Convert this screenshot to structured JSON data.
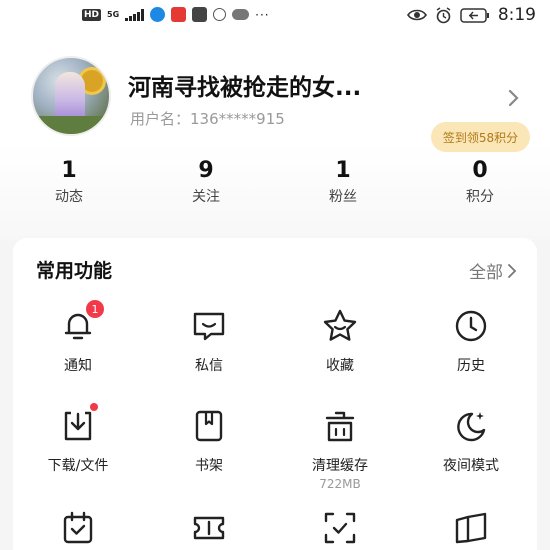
{
  "status_bar": {
    "hd": "HD",
    "network": "5G",
    "time": "8:19"
  },
  "profile": {
    "username": "河南寻找被抢走的女...",
    "user_id_label": "用户名：",
    "user_id_value": "136*****915",
    "signin_label": "签到领58积分"
  },
  "stats": [
    {
      "value": "1",
      "label": "动态"
    },
    {
      "value": "9",
      "label": "关注"
    },
    {
      "value": "1",
      "label": "粉丝"
    },
    {
      "value": "0",
      "label": "积分"
    }
  ],
  "functions": {
    "title": "常用功能",
    "view_all": "全部",
    "items": [
      {
        "label": "通知",
        "icon": "bell-icon",
        "badge": "1"
      },
      {
        "label": "私信",
        "icon": "message-icon"
      },
      {
        "label": "收藏",
        "icon": "star-icon"
      },
      {
        "label": "历史",
        "icon": "clock-icon"
      },
      {
        "label": "下载/文件",
        "icon": "download-icon",
        "dot": true
      },
      {
        "label": "书架",
        "icon": "bookshelf-icon"
      },
      {
        "label": "清理缓存",
        "icon": "trash-icon",
        "sub": "722MB"
      },
      {
        "label": "夜间模式",
        "icon": "moon-icon"
      },
      {
        "label": "",
        "icon": "calendar-check-icon"
      },
      {
        "label": "",
        "icon": "ticket-icon"
      },
      {
        "label": "",
        "icon": "scan-icon"
      },
      {
        "label": "",
        "icon": "book-icon"
      }
    ]
  },
  "colors": {
    "badge_red": "#f1394a",
    "signin_bg": "#fbe6b8",
    "signin_text": "#b07a18"
  }
}
